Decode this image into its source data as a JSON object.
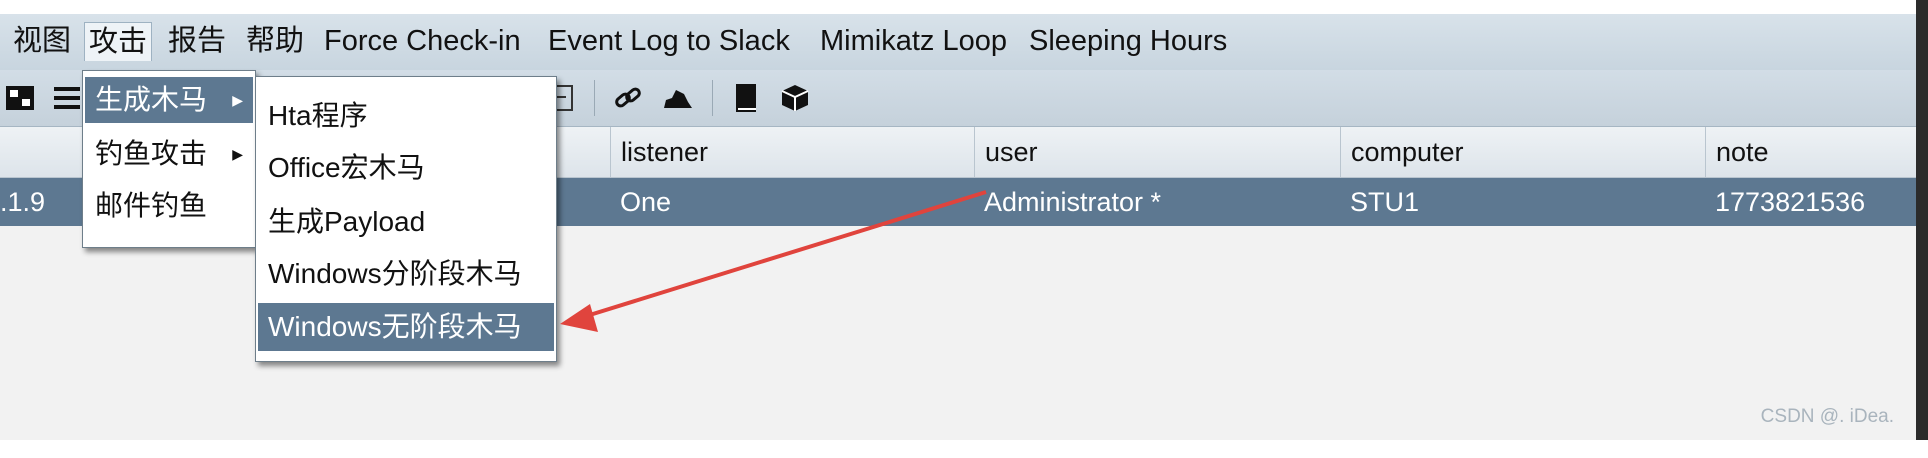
{
  "menubar": {
    "items": [
      "视图",
      "攻击",
      "报告",
      "帮助",
      "Force Check-in",
      "Event Log to Slack",
      "Mimikatz Loop",
      "Sleeping Hours"
    ]
  },
  "attack_menu": {
    "items": [
      "生成木马",
      "钓鱼攻击",
      "邮件钓鱼"
    ]
  },
  "payload_submenu": {
    "items": [
      "Hta程序",
      "Office宏木马",
      "生成Payload",
      "Windows分阶段木马",
      "Windows无阶段木马"
    ]
  },
  "table": {
    "headers": [
      "listener",
      "user",
      "computer",
      "note"
    ],
    "row": {
      "internal": ".1.9",
      "listener": "One",
      "user": "Administrator *",
      "computer": "STU1",
      "note": "1773821536"
    }
  },
  "watermark": "CSDN @. iDea.",
  "icons": [
    "pivot-icon",
    "list-icon",
    "gear-icon",
    "coffee-icon",
    "file-icon",
    "console-icon",
    "link-icon",
    "cloud-icon",
    "book-icon",
    "cube-icon"
  ],
  "colors": {
    "selection": "#5d7891",
    "annotation_arrow": "#e0443d"
  }
}
